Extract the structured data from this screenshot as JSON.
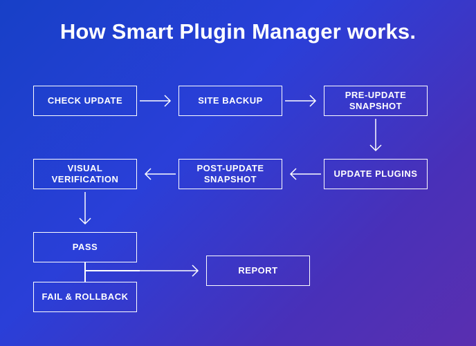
{
  "title": "How Smart Plugin Manager works.",
  "steps": {
    "check_update": "CHECK UPDATE",
    "site_backup": "SITE BACKUP",
    "pre_update_snapshot": "PRE-UPDATE SNAPSHOT",
    "update_plugins": "UPDATE PLUGINS",
    "post_update_snapshot": "POST-UPDATE SNAPSHOT",
    "visual_verification": "VISUAL VERIFICATION",
    "pass": "PASS",
    "fail_rollback": "FAIL & ROLLBACK",
    "report": "REPORT"
  }
}
